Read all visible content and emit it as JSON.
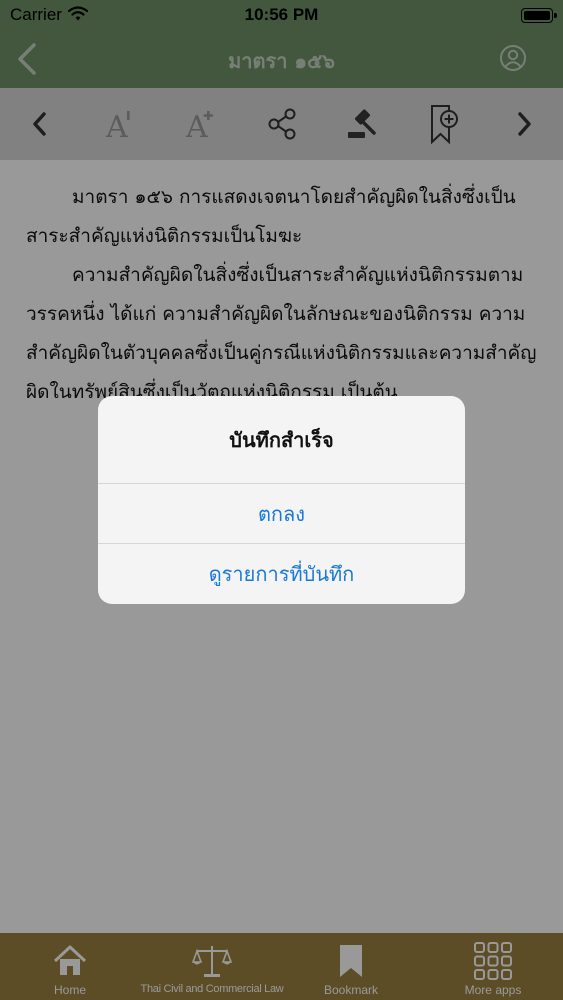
{
  "status": {
    "carrier": "Carrier",
    "time": "10:56 PM"
  },
  "nav": {
    "title": "มาตรา ๑๕๖"
  },
  "toolbar": {
    "icons": [
      "chevron-left-icon",
      "font-decrease-icon",
      "font-increase-icon",
      "share-icon",
      "gavel-icon",
      "bookmark-add-icon",
      "chevron-right-icon"
    ]
  },
  "article": {
    "paragraphs": [
      "มาตรา ๑๕๖  การแสดงเจตนาโดยสำคัญผิดในสิ่งซึ่งเป็นสาระสำคัญแห่งนิติกรรมเป็นโมฆะ",
      "ความสำคัญผิดในสิ่งซึ่งเป็นสาระสำคัญแห่งนิติกรรมตามวรรคหนึ่ง ได้แก่ ความสำคัญผิดในลักษณะของนิติกรรม  ความสำคัญผิดในตัวบุคคลซึ่งเป็นคู่กรณีแห่งนิติกรรมและความสำคัญผิดในทรัพย์สินซึ่งเป็นวัตถุแห่งนิติกรรม เป็นต้น"
    ]
  },
  "alert": {
    "title": "บันทึกสำเร็จ",
    "ok_label": "ตกลง",
    "view_label": "ดูรายการที่บันทึก"
  },
  "tabs": [
    {
      "label": "Home",
      "icon": "home-icon"
    },
    {
      "label": "Thai Civil and Commercial Law",
      "icon": "scales-icon"
    },
    {
      "label": "Bookmark",
      "icon": "bookmark-icon"
    },
    {
      "label": "More apps",
      "icon": "grid-icon"
    }
  ],
  "colors": {
    "header": "#6f9168",
    "tabbar": "#9a8040",
    "alert_button": "#1a78d6"
  }
}
